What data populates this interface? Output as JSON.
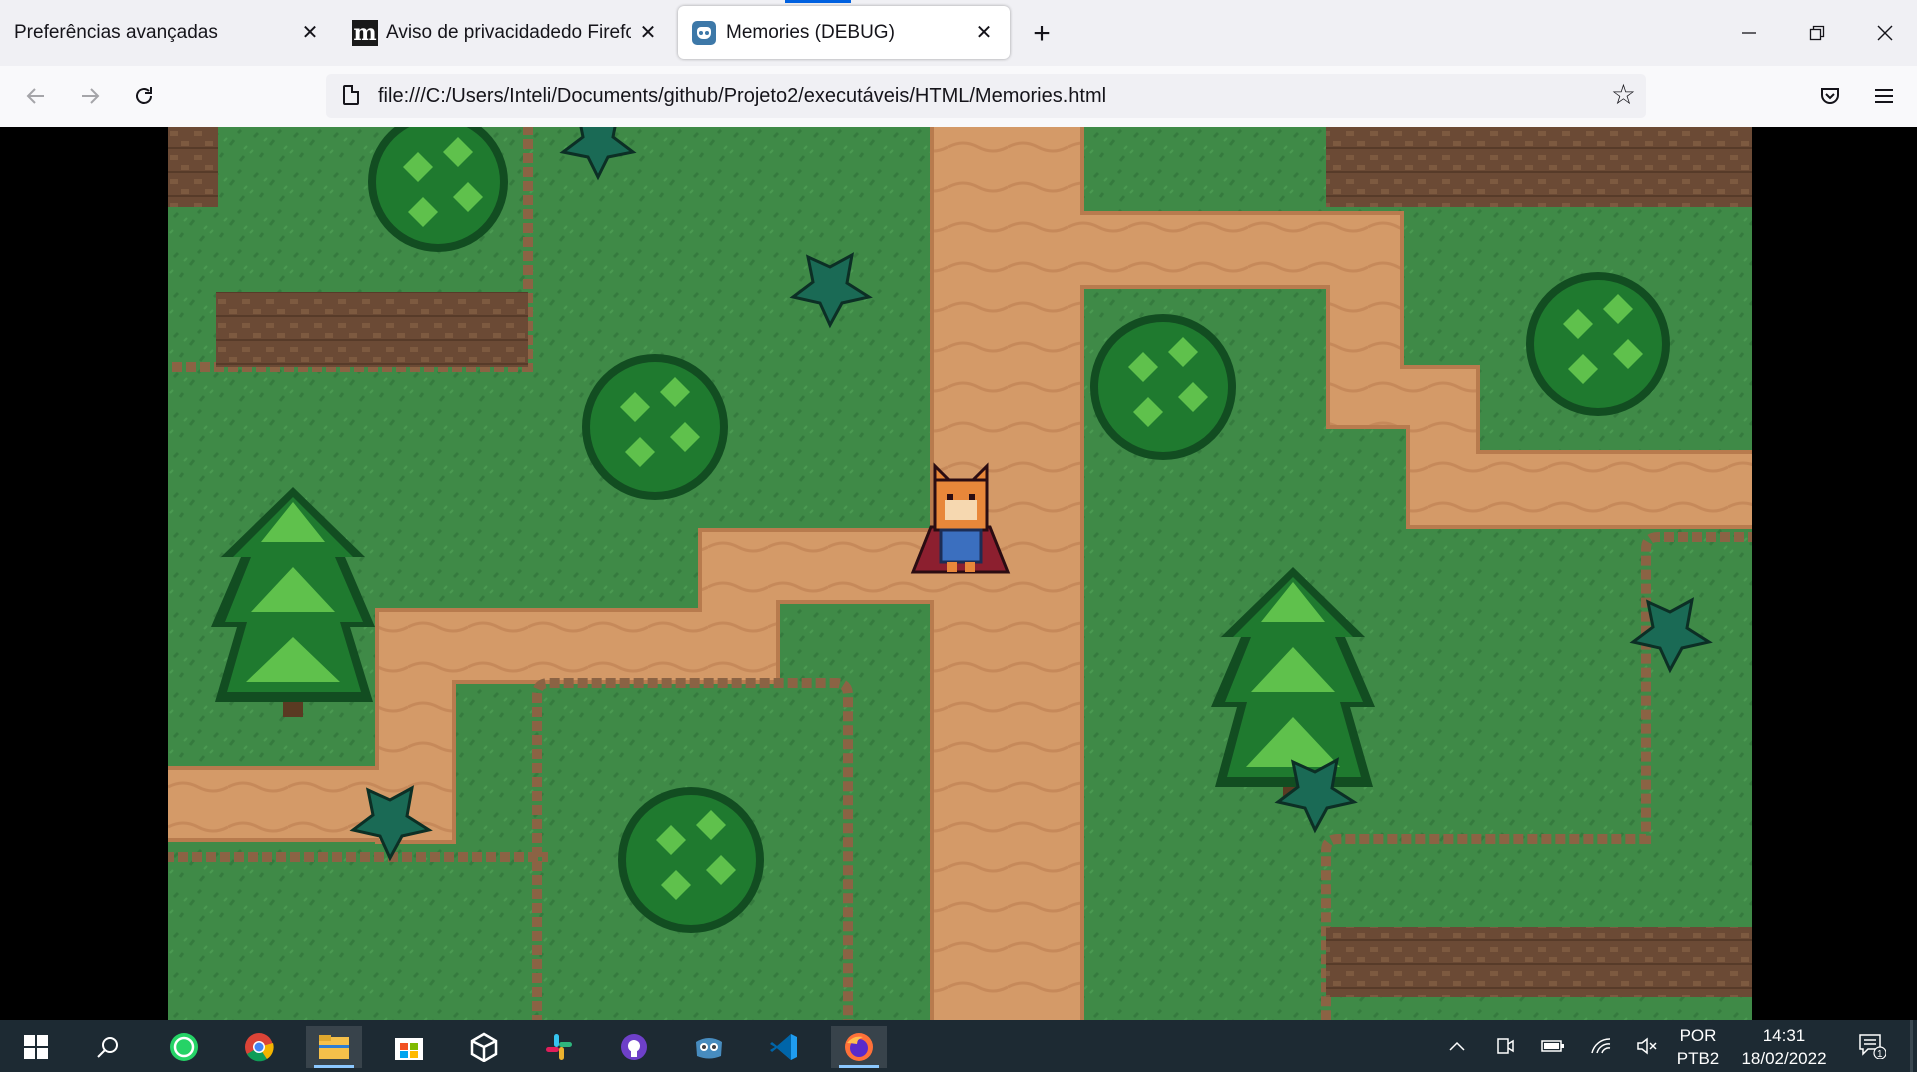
{
  "browser": {
    "tabs": [
      {
        "title": "Preferências avançadas",
        "favicon": "none"
      },
      {
        "title": "Aviso de privacidadedo Firefox",
        "favicon": "mozilla-m-icon"
      },
      {
        "title": "Memories (DEBUG)",
        "favicon": "godot-icon",
        "active": true
      }
    ],
    "close_glyph": "✕",
    "new_tab_glyph": "+",
    "window_controls": {
      "minimize": "—",
      "maximize": "❐",
      "close": "✕"
    },
    "nav": {
      "back": "←",
      "forward": "→",
      "reload": "↻"
    },
    "url": "file:///C:/Users/Inteli/Documents/github/Projeto2/executáveis/HTML/Memories.html",
    "bookmark_star": "☆",
    "pocket_icon": "pocket-icon",
    "menu_glyph": "≡"
  },
  "game": {
    "title": "Memories (DEBUG)",
    "colors": {
      "grass": "#3f8a47",
      "grass_dark": "#357a3e",
      "path": "#d49a68",
      "path_edge": "#b87b4e",
      "cliff": "#6b4a35",
      "tree": "#1f7a2f",
      "tree_light": "#5fc14c"
    }
  },
  "taskbar": {
    "icons": [
      "windows-start-icon",
      "search-icon",
      "whatsapp-icon",
      "chrome-icon",
      "file-explorer-icon",
      "microsoft-store-icon",
      "unity-icon",
      "slack-icon",
      "github-desktop-icon",
      "godot-icon",
      "vscode-icon",
      "firefox-icon"
    ],
    "language": "POR",
    "layout": "PTB2",
    "time": "14:31",
    "date": "18/02/2022",
    "notification_count": "1"
  }
}
